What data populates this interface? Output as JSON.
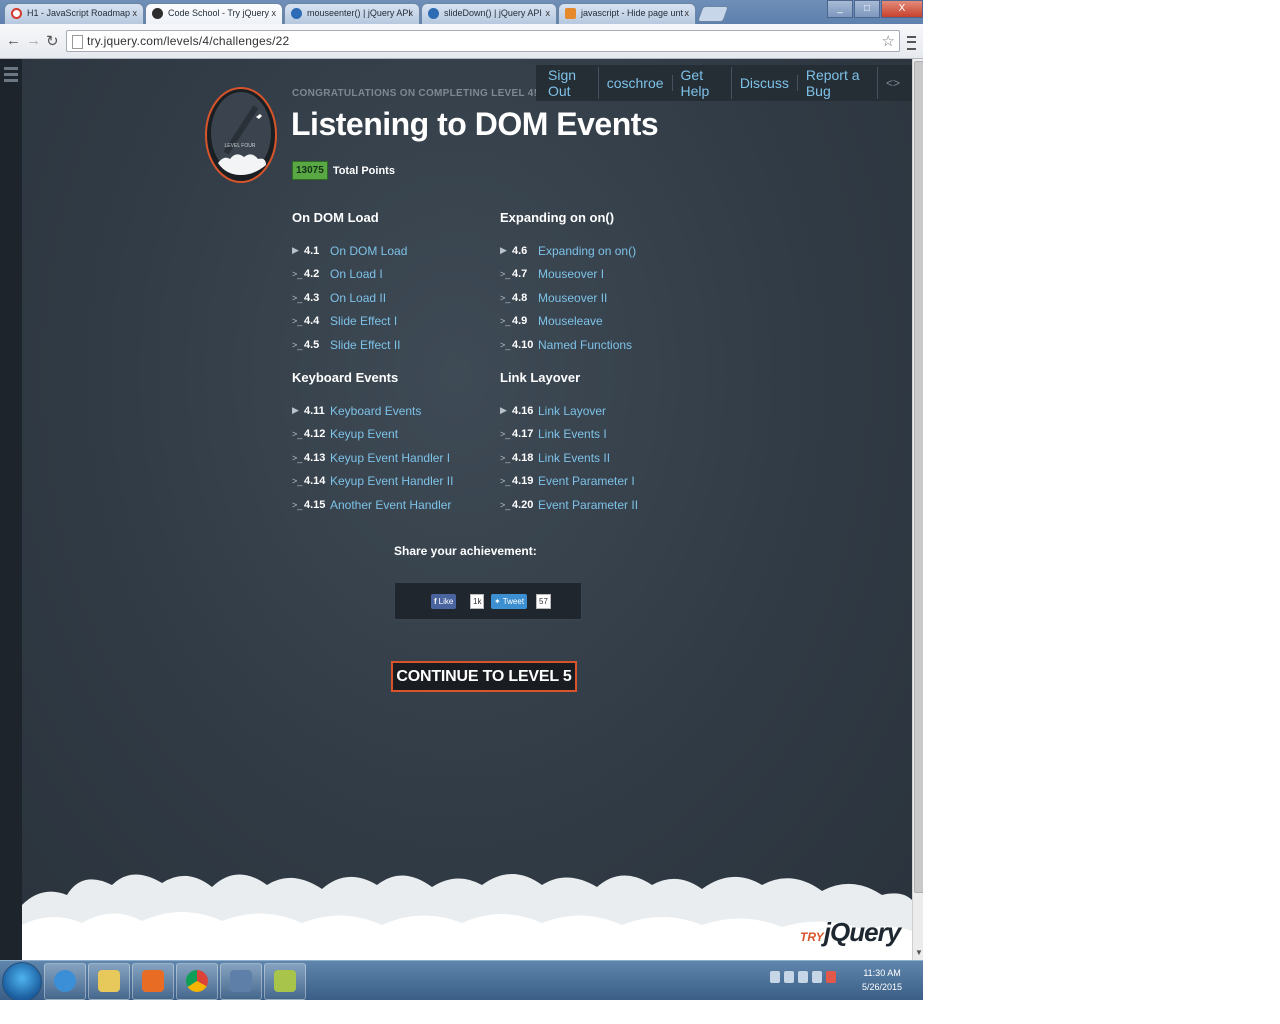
{
  "browser": {
    "tabs": [
      {
        "label": "H1 - JavaScript Roadmap",
        "active": false,
        "favicon_color": "#d33a2c"
      },
      {
        "label": "Code School - Try jQuery",
        "active": true,
        "favicon_color": "#2d2d2d"
      },
      {
        "label": "mouseenter() | jQuery API",
        "active": false,
        "favicon_color": "#2e6bb5"
      },
      {
        "label": "slideDown() | jQuery API",
        "active": false,
        "favicon_color": "#2e6bb5"
      },
      {
        "label": "javascript - Hide page unt",
        "active": false,
        "favicon_color": "#e5892a"
      }
    ],
    "tab_close": "x",
    "url": "try.jquery.com/levels/4/challenges/22",
    "window_buttons": {
      "minimize": "_",
      "maximize": "□",
      "close": "X"
    }
  },
  "topnav": {
    "items": [
      "Sign Out",
      "coschroe",
      "Get Help",
      "Discuss",
      "Report a Bug"
    ],
    "collapse_icon": "<>"
  },
  "header": {
    "badge_text": "LEVEL FOUR",
    "congrats": "CONGRATULATIONS ON COMPLETING LEVEL 4!",
    "title": "Listening to DOM Events",
    "points": "13075",
    "points_label": "Total Points"
  },
  "sections": [
    {
      "title": "On DOM Load",
      "lessons": [
        {
          "num": "4.1",
          "name": "On DOM Load"
        },
        {
          "num": "4.2",
          "name": "On Load I"
        },
        {
          "num": "4.3",
          "name": "On Load II"
        },
        {
          "num": "4.4",
          "name": "Slide Effect I"
        },
        {
          "num": "4.5",
          "name": "Slide Effect II"
        }
      ]
    },
    {
      "title": "Expanding on on()",
      "lessons": [
        {
          "num": "4.6",
          "name": "Expanding on on()"
        },
        {
          "num": "4.7",
          "name": "Mouseover I"
        },
        {
          "num": "4.8",
          "name": "Mouseover II"
        },
        {
          "num": "4.9",
          "name": "Mouseleave"
        },
        {
          "num": "4.10",
          "name": "Named Functions"
        }
      ]
    },
    {
      "title": "Keyboard Events",
      "lessons": [
        {
          "num": "4.11",
          "name": "Keyboard Events"
        },
        {
          "num": "4.12",
          "name": "Keyup Event"
        },
        {
          "num": "4.13",
          "name": "Keyup Event Handler I"
        },
        {
          "num": "4.14",
          "name": "Keyup Event Handler II"
        },
        {
          "num": "4.15",
          "name": "Another Event Handler"
        }
      ]
    },
    {
      "title": "Link Layover",
      "lessons": [
        {
          "num": "4.16",
          "name": "Link Layover"
        },
        {
          "num": "4.17",
          "name": "Link Events I"
        },
        {
          "num": "4.18",
          "name": "Link Events II"
        },
        {
          "num": "4.19",
          "name": "Event Parameter I"
        },
        {
          "num": "4.20",
          "name": "Event Parameter II"
        }
      ]
    }
  ],
  "share": {
    "title": "Share your achievement:",
    "like_label": "Like",
    "like_count": "1k",
    "tweet_label": "Tweet",
    "tweet_count": "57"
  },
  "continue_label": "CONTINUE TO LEVEL 5",
  "logo": {
    "try": "TRY",
    "jquery": "jQuery"
  },
  "taskbar": {
    "time": "11:30 AM",
    "date": "5/26/2015"
  },
  "colors": {
    "link": "#7ec2e8",
    "points_green": "#5aa843",
    "accent_orange": "#d8542a",
    "page_bg": "#313b45"
  }
}
